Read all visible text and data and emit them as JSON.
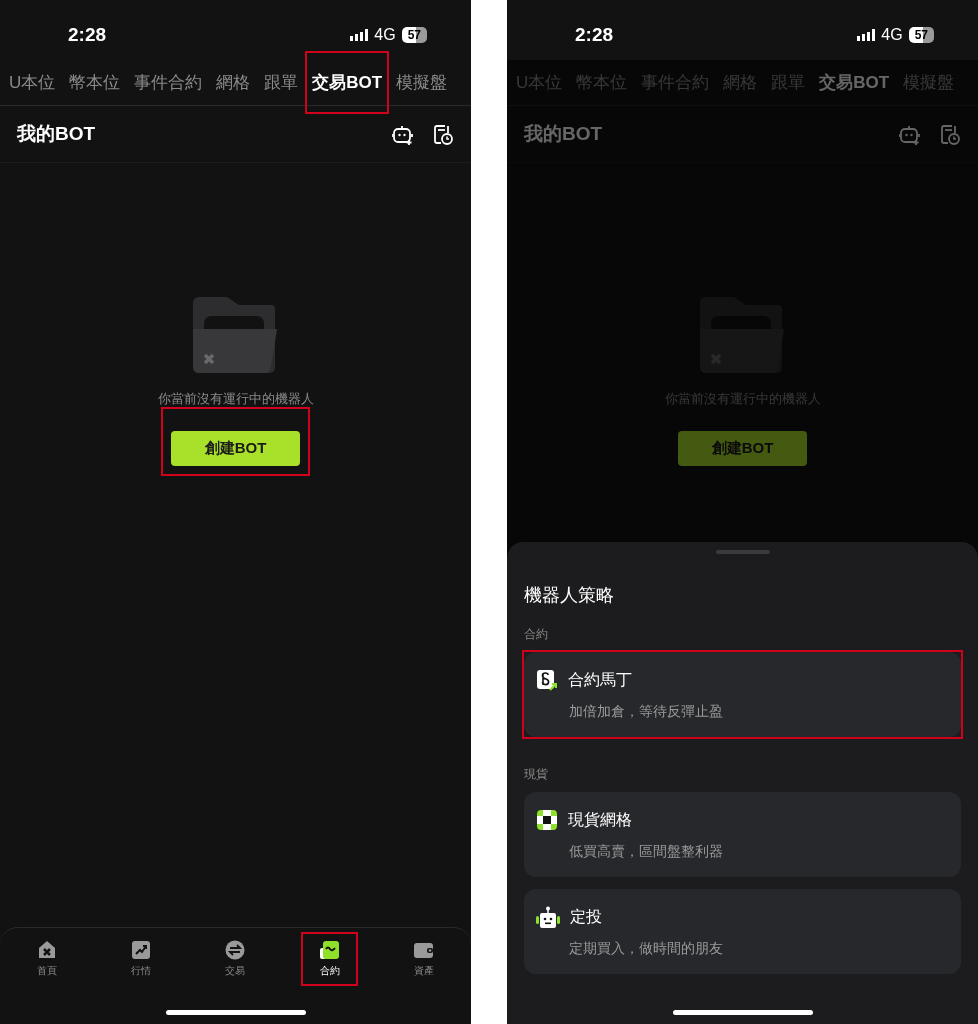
{
  "screens": [
    {
      "status_bar": {
        "time": "2:28",
        "network": "4G",
        "battery": "57"
      },
      "tabs": [
        {
          "label": "U本位",
          "selected": false,
          "highlighted": false
        },
        {
          "label": "幣本位",
          "selected": false,
          "highlighted": false
        },
        {
          "label": "事件合約",
          "selected": false,
          "highlighted": false
        },
        {
          "label": "網格",
          "selected": false,
          "highlighted": false
        },
        {
          "label": "跟單",
          "selected": false,
          "highlighted": false
        },
        {
          "label": "交易BOT",
          "selected": true,
          "highlighted": true
        },
        {
          "label": "模擬盤",
          "selected": false,
          "highlighted": false
        }
      ],
      "header": {
        "title": "我的BOT"
      },
      "empty_state": {
        "message": "你當前沒有運行中的機器人",
        "button": {
          "label": "創建BOT",
          "highlighted": true
        }
      },
      "bottom_nav": [
        {
          "label": "首頁",
          "selected": false,
          "highlighted": false
        },
        {
          "label": "行情",
          "selected": false,
          "highlighted": false
        },
        {
          "label": "交易",
          "selected": false,
          "highlighted": false
        },
        {
          "label": "合約",
          "selected": true,
          "highlighted": true
        },
        {
          "label": "資產",
          "selected": false,
          "highlighted": false
        }
      ],
      "dimmed": false
    },
    {
      "status_bar": {
        "time": "2:28",
        "network": "4G",
        "battery": "57"
      },
      "tabs": [
        {
          "label": "U本位",
          "selected": false,
          "highlighted": false
        },
        {
          "label": "幣本位",
          "selected": false,
          "highlighted": false
        },
        {
          "label": "事件合約",
          "selected": false,
          "highlighted": false
        },
        {
          "label": "網格",
          "selected": false,
          "highlighted": false
        },
        {
          "label": "跟單",
          "selected": false,
          "highlighted": false
        },
        {
          "label": "交易BOT",
          "selected": true,
          "highlighted": false
        },
        {
          "label": "模擬盤",
          "selected": false,
          "highlighted": false
        }
      ],
      "header": {
        "title": "我的BOT"
      },
      "empty_state": {
        "message": "你當前沒有運行中的機器人",
        "button": {
          "label": "創建BOT",
          "highlighted": false
        }
      },
      "dimmed": true,
      "sheet": {
        "title": "機器人策略",
        "sections": [
          {
            "label": "合約",
            "items": [
              {
                "kind": "dollar",
                "title": "合約馬丁",
                "subtitle": "加倍加倉，等待反彈止盈",
                "highlighted": true
              }
            ]
          },
          {
            "label": "現貨",
            "items": [
              {
                "kind": "grid",
                "title": "現貨網格",
                "subtitle": "低買高賣，區間盤整利器",
                "highlighted": false
              },
              {
                "kind": "robot",
                "title": "定投",
                "subtitle": "定期買入，做時間的朋友",
                "highlighted": false
              }
            ]
          }
        ]
      }
    }
  ]
}
